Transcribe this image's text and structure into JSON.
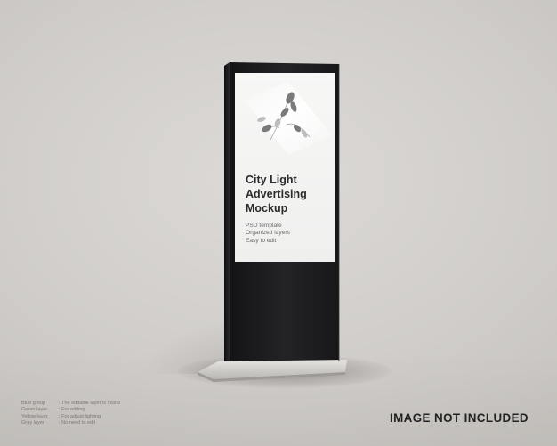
{
  "colors": {
    "background": "#d3d0cc",
    "kiosk_body": "#1c1c1e",
    "screen": "#f4f4f3",
    "base_plate": "#c9c7c4",
    "title_text": "#2b2b2b",
    "badge_text": "#222222"
  },
  "poster": {
    "title_lines": [
      "City Light",
      "Advertising",
      "Mockup"
    ],
    "subtitle_lines": [
      "PSD template",
      "Organized layers",
      "Easy to edit"
    ]
  },
  "legend": [
    {
      "key": "Blue group",
      "value": ": The editable layer is inside"
    },
    {
      "key": "Green layer",
      "value": ": For editing"
    },
    {
      "key": "Yellow layer",
      "value": ": For adjust lighting"
    },
    {
      "key": "Gray layer",
      "value": ": No need to edit"
    }
  ],
  "badge": {
    "label": "IMAGE NOT INCLUDED"
  }
}
